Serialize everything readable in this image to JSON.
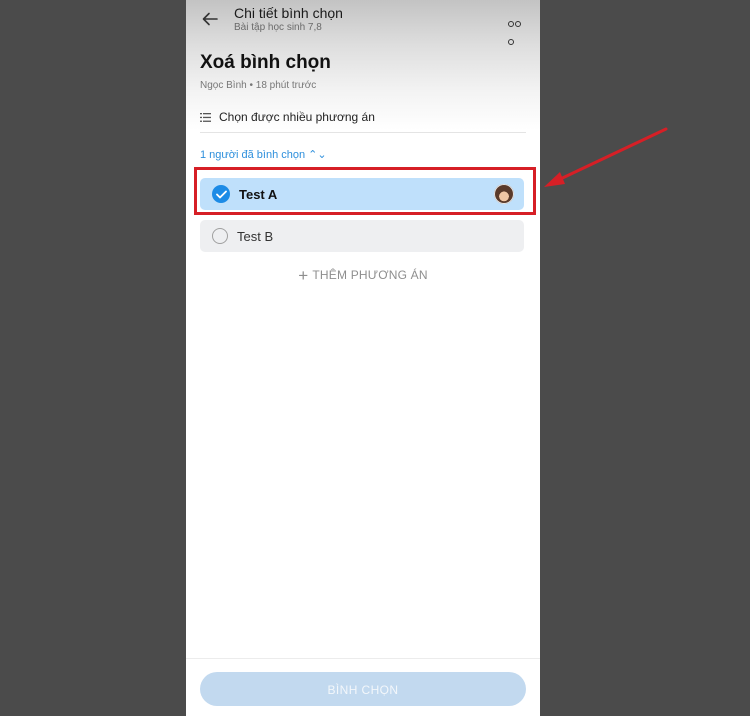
{
  "header": {
    "title": "Chi tiết bình chọn",
    "subtitle": "Bài tập học sinh 7,8"
  },
  "poll": {
    "title": "Xoá bình chọn",
    "meta": "Ngọc Bình • 18 phút trước",
    "multi_choice_label": "Chọn được nhiều phương án",
    "voters_link": "1 người đã bình chọn ⌃⌄",
    "options": [
      {
        "label": "Test A",
        "selected": true
      },
      {
        "label": "Test B",
        "selected": false
      }
    ],
    "add_option_label": "THÊM PHƯƠNG ÁN"
  },
  "footer": {
    "vote_button": "BÌNH CHỌN"
  },
  "colors": {
    "accent": "#1c8be6",
    "selected_option_bg": "#bfe0fb",
    "highlight": "#d61f26"
  }
}
